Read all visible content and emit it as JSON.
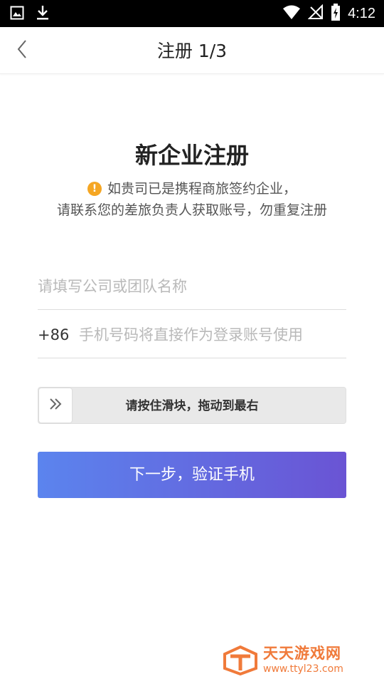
{
  "status_bar": {
    "time": "4:12",
    "left_icons": [
      "image-icon",
      "download-icon"
    ],
    "right_icons": [
      "wifi-icon",
      "no-signal-icon",
      "battery-charging-icon"
    ]
  },
  "nav": {
    "back_icon": "chevron-left-icon",
    "title": "注册 1/3"
  },
  "headline": "新企业注册",
  "notice": {
    "icon": "warning-icon",
    "icon_symbol": "!",
    "line1": "如贵司已是携程商旅签约企业，",
    "line2": "请联系您的差旅负责人获取账号，勿重复注册"
  },
  "form": {
    "company": {
      "placeholder": "请填写公司或团队名称",
      "value": ""
    },
    "phone": {
      "country_code": "+86",
      "placeholder": "手机号码将直接作为登录账号使用",
      "value": ""
    }
  },
  "slider": {
    "handle_icon": "double-chevron-right-icon",
    "label": "请按住滑块，拖动到最右",
    "progress": 0
  },
  "primary_button": {
    "label": "下一步，验证手机"
  },
  "watermark": {
    "name": "天天游戏网",
    "url": "www.ttyl23.com"
  },
  "colors": {
    "accent_start": "#5b84ee",
    "accent_end": "#6a54d4",
    "warning": "#f5a623",
    "watermark": "#f07a3a"
  }
}
